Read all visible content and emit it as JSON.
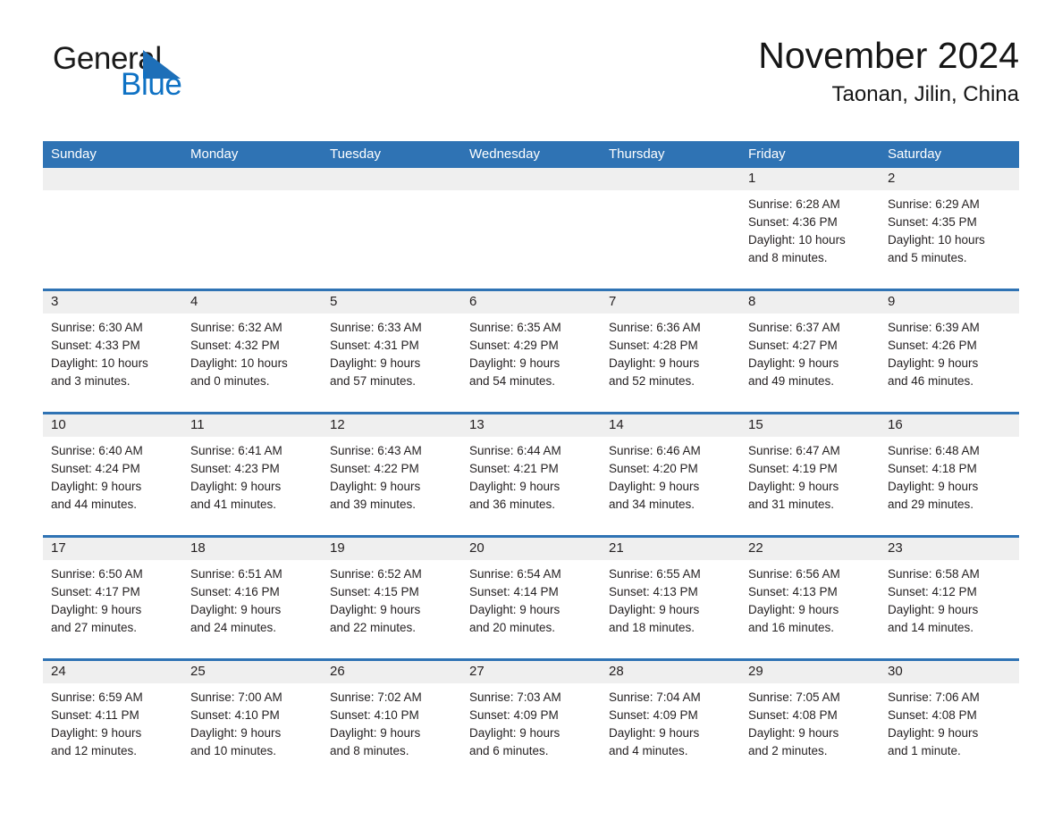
{
  "brand": {
    "name_part1": "General",
    "name_part2": "Blue",
    "accent_color": "#0f72c4",
    "triangle_color": "#1e6fb8"
  },
  "header": {
    "month_title": "November 2024",
    "location": "Taonan, Jilin, China"
  },
  "calendar": {
    "header_bg": "#2f73b4",
    "daynum_band_bg": "#efefef",
    "weekdays": [
      "Sunday",
      "Monday",
      "Tuesday",
      "Wednesday",
      "Thursday",
      "Friday",
      "Saturday"
    ],
    "weeks": [
      [
        {
          "day": "",
          "lines": []
        },
        {
          "day": "",
          "lines": []
        },
        {
          "day": "",
          "lines": []
        },
        {
          "day": "",
          "lines": []
        },
        {
          "day": "",
          "lines": []
        },
        {
          "day": "1",
          "lines": [
            "Sunrise: 6:28 AM",
            "Sunset: 4:36 PM",
            "Daylight: 10 hours",
            "and 8 minutes."
          ]
        },
        {
          "day": "2",
          "lines": [
            "Sunrise: 6:29 AM",
            "Sunset: 4:35 PM",
            "Daylight: 10 hours",
            "and 5 minutes."
          ]
        }
      ],
      [
        {
          "day": "3",
          "lines": [
            "Sunrise: 6:30 AM",
            "Sunset: 4:33 PM",
            "Daylight: 10 hours",
            "and 3 minutes."
          ]
        },
        {
          "day": "4",
          "lines": [
            "Sunrise: 6:32 AM",
            "Sunset: 4:32 PM",
            "Daylight: 10 hours",
            "and 0 minutes."
          ]
        },
        {
          "day": "5",
          "lines": [
            "Sunrise: 6:33 AM",
            "Sunset: 4:31 PM",
            "Daylight: 9 hours",
            "and 57 minutes."
          ]
        },
        {
          "day": "6",
          "lines": [
            "Sunrise: 6:35 AM",
            "Sunset: 4:29 PM",
            "Daylight: 9 hours",
            "and 54 minutes."
          ]
        },
        {
          "day": "7",
          "lines": [
            "Sunrise: 6:36 AM",
            "Sunset: 4:28 PM",
            "Daylight: 9 hours",
            "and 52 minutes."
          ]
        },
        {
          "day": "8",
          "lines": [
            "Sunrise: 6:37 AM",
            "Sunset: 4:27 PM",
            "Daylight: 9 hours",
            "and 49 minutes."
          ]
        },
        {
          "day": "9",
          "lines": [
            "Sunrise: 6:39 AM",
            "Sunset: 4:26 PM",
            "Daylight: 9 hours",
            "and 46 minutes."
          ]
        }
      ],
      [
        {
          "day": "10",
          "lines": [
            "Sunrise: 6:40 AM",
            "Sunset: 4:24 PM",
            "Daylight: 9 hours",
            "and 44 minutes."
          ]
        },
        {
          "day": "11",
          "lines": [
            "Sunrise: 6:41 AM",
            "Sunset: 4:23 PM",
            "Daylight: 9 hours",
            "and 41 minutes."
          ]
        },
        {
          "day": "12",
          "lines": [
            "Sunrise: 6:43 AM",
            "Sunset: 4:22 PM",
            "Daylight: 9 hours",
            "and 39 minutes."
          ]
        },
        {
          "day": "13",
          "lines": [
            "Sunrise: 6:44 AM",
            "Sunset: 4:21 PM",
            "Daylight: 9 hours",
            "and 36 minutes."
          ]
        },
        {
          "day": "14",
          "lines": [
            "Sunrise: 6:46 AM",
            "Sunset: 4:20 PM",
            "Daylight: 9 hours",
            "and 34 minutes."
          ]
        },
        {
          "day": "15",
          "lines": [
            "Sunrise: 6:47 AM",
            "Sunset: 4:19 PM",
            "Daylight: 9 hours",
            "and 31 minutes."
          ]
        },
        {
          "day": "16",
          "lines": [
            "Sunrise: 6:48 AM",
            "Sunset: 4:18 PM",
            "Daylight: 9 hours",
            "and 29 minutes."
          ]
        }
      ],
      [
        {
          "day": "17",
          "lines": [
            "Sunrise: 6:50 AM",
            "Sunset: 4:17 PM",
            "Daylight: 9 hours",
            "and 27 minutes."
          ]
        },
        {
          "day": "18",
          "lines": [
            "Sunrise: 6:51 AM",
            "Sunset: 4:16 PM",
            "Daylight: 9 hours",
            "and 24 minutes."
          ]
        },
        {
          "day": "19",
          "lines": [
            "Sunrise: 6:52 AM",
            "Sunset: 4:15 PM",
            "Daylight: 9 hours",
            "and 22 minutes."
          ]
        },
        {
          "day": "20",
          "lines": [
            "Sunrise: 6:54 AM",
            "Sunset: 4:14 PM",
            "Daylight: 9 hours",
            "and 20 minutes."
          ]
        },
        {
          "day": "21",
          "lines": [
            "Sunrise: 6:55 AM",
            "Sunset: 4:13 PM",
            "Daylight: 9 hours",
            "and 18 minutes."
          ]
        },
        {
          "day": "22",
          "lines": [
            "Sunrise: 6:56 AM",
            "Sunset: 4:13 PM",
            "Daylight: 9 hours",
            "and 16 minutes."
          ]
        },
        {
          "day": "23",
          "lines": [
            "Sunrise: 6:58 AM",
            "Sunset: 4:12 PM",
            "Daylight: 9 hours",
            "and 14 minutes."
          ]
        }
      ],
      [
        {
          "day": "24",
          "lines": [
            "Sunrise: 6:59 AM",
            "Sunset: 4:11 PM",
            "Daylight: 9 hours",
            "and 12 minutes."
          ]
        },
        {
          "day": "25",
          "lines": [
            "Sunrise: 7:00 AM",
            "Sunset: 4:10 PM",
            "Daylight: 9 hours",
            "and 10 minutes."
          ]
        },
        {
          "day": "26",
          "lines": [
            "Sunrise: 7:02 AM",
            "Sunset: 4:10 PM",
            "Daylight: 9 hours",
            "and 8 minutes."
          ]
        },
        {
          "day": "27",
          "lines": [
            "Sunrise: 7:03 AM",
            "Sunset: 4:09 PM",
            "Daylight: 9 hours",
            "and 6 minutes."
          ]
        },
        {
          "day": "28",
          "lines": [
            "Sunrise: 7:04 AM",
            "Sunset: 4:09 PM",
            "Daylight: 9 hours",
            "and 4 minutes."
          ]
        },
        {
          "day": "29",
          "lines": [
            "Sunrise: 7:05 AM",
            "Sunset: 4:08 PM",
            "Daylight: 9 hours",
            "and 2 minutes."
          ]
        },
        {
          "day": "30",
          "lines": [
            "Sunrise: 7:06 AM",
            "Sunset: 4:08 PM",
            "Daylight: 9 hours",
            "and 1 minute."
          ]
        }
      ]
    ]
  }
}
